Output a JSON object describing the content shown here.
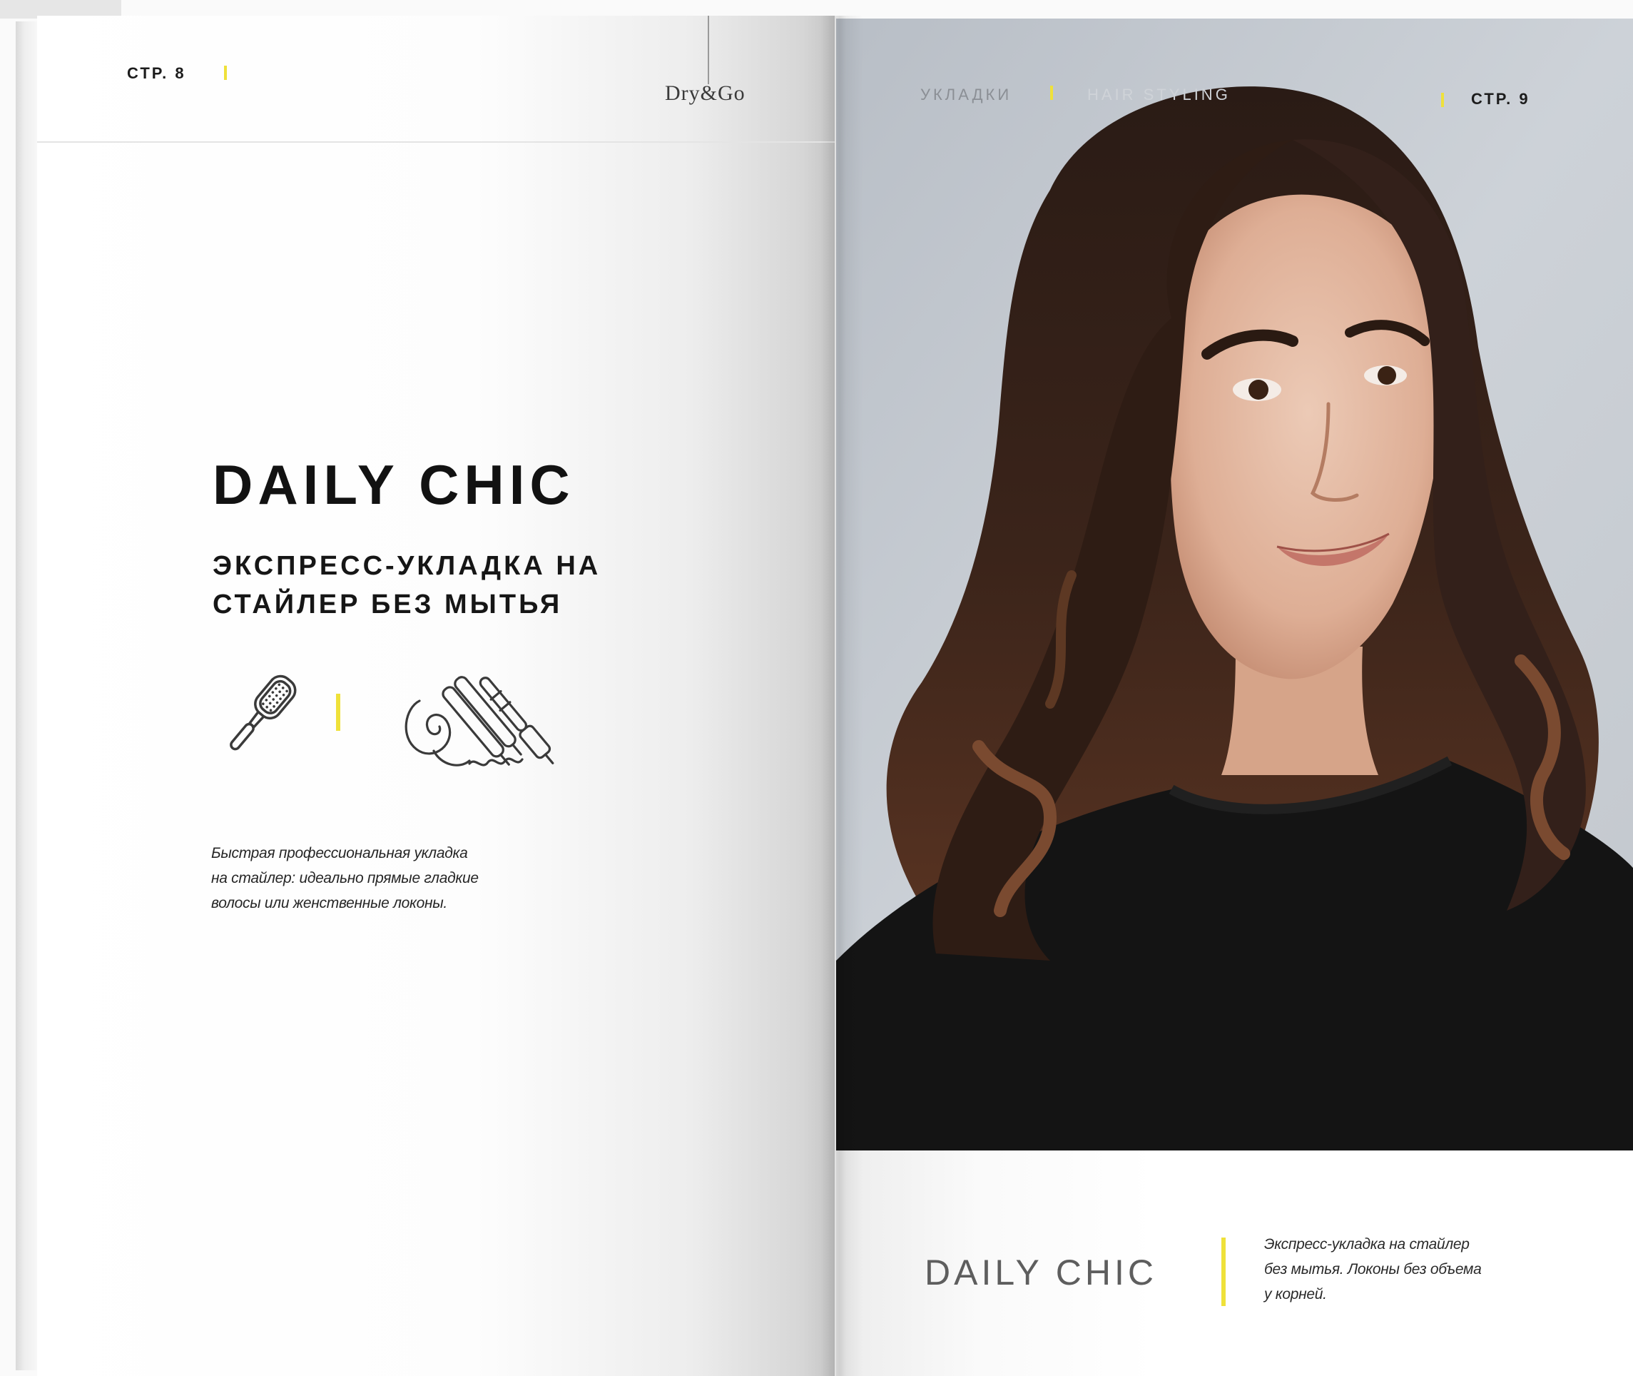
{
  "colors": {
    "accent_yellow": "#efe13a",
    "text_dark": "#121212",
    "photo_background": "#c9ced3",
    "sweater": "#141414"
  },
  "left_page": {
    "page_number": "СТР. 8",
    "logo": "Dry&Go",
    "title": "DAILY CHIC",
    "subtitle_lines": [
      "ЭКСПРЕСС-УКЛАДКА НА",
      "СТАЙЛЕР БЕЗ МЫТЬЯ"
    ],
    "icons": [
      "hairbrush-icon",
      "styling-tools-icon"
    ],
    "description_lines": [
      "Быстрая профессиональная укладка",
      "на стайлер: идеально прямые гладкие",
      "волосы или женственные локоны."
    ]
  },
  "right_page": {
    "section_ru": "УКЛАДКИ",
    "section_en": "HAIR STYLING",
    "page_number": "СТР. 9",
    "photo": "portrait-photo",
    "caption_title": "DAILY CHIC",
    "caption_lines": [
      "Экспресс-укладка на стайлер",
      "без мытья. Локоны без объема",
      "у корней."
    ]
  }
}
